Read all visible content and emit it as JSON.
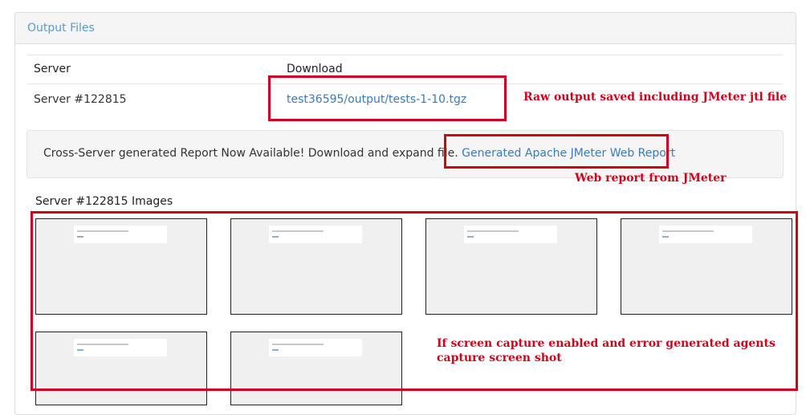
{
  "panel": {
    "title": "Output Files"
  },
  "table": {
    "headers": [
      "Server",
      "Download"
    ],
    "rows": [
      {
        "server": "Server #122815",
        "download": "test36595/output/tests-1-10.tgz"
      }
    ]
  },
  "report": {
    "text": "Cross-Server generated Report Now Available! Download and expand file.",
    "link": "Generated Apache JMeter Web Report"
  },
  "images": {
    "title": "Server #122815 Images",
    "thumbnail_count": 6
  },
  "annotations": {
    "raw_output": "Raw output saved including JMeter jtl file",
    "web_report": "Web report from JMeter",
    "screen_capture_line1": "If screen capture enabled and error generated agents",
    "screen_capture_line2": "capture screen shot"
  },
  "colors": {
    "annotation": "#d0021b",
    "link": "#3a7ab8",
    "panel_title": "#5c9bc9"
  }
}
